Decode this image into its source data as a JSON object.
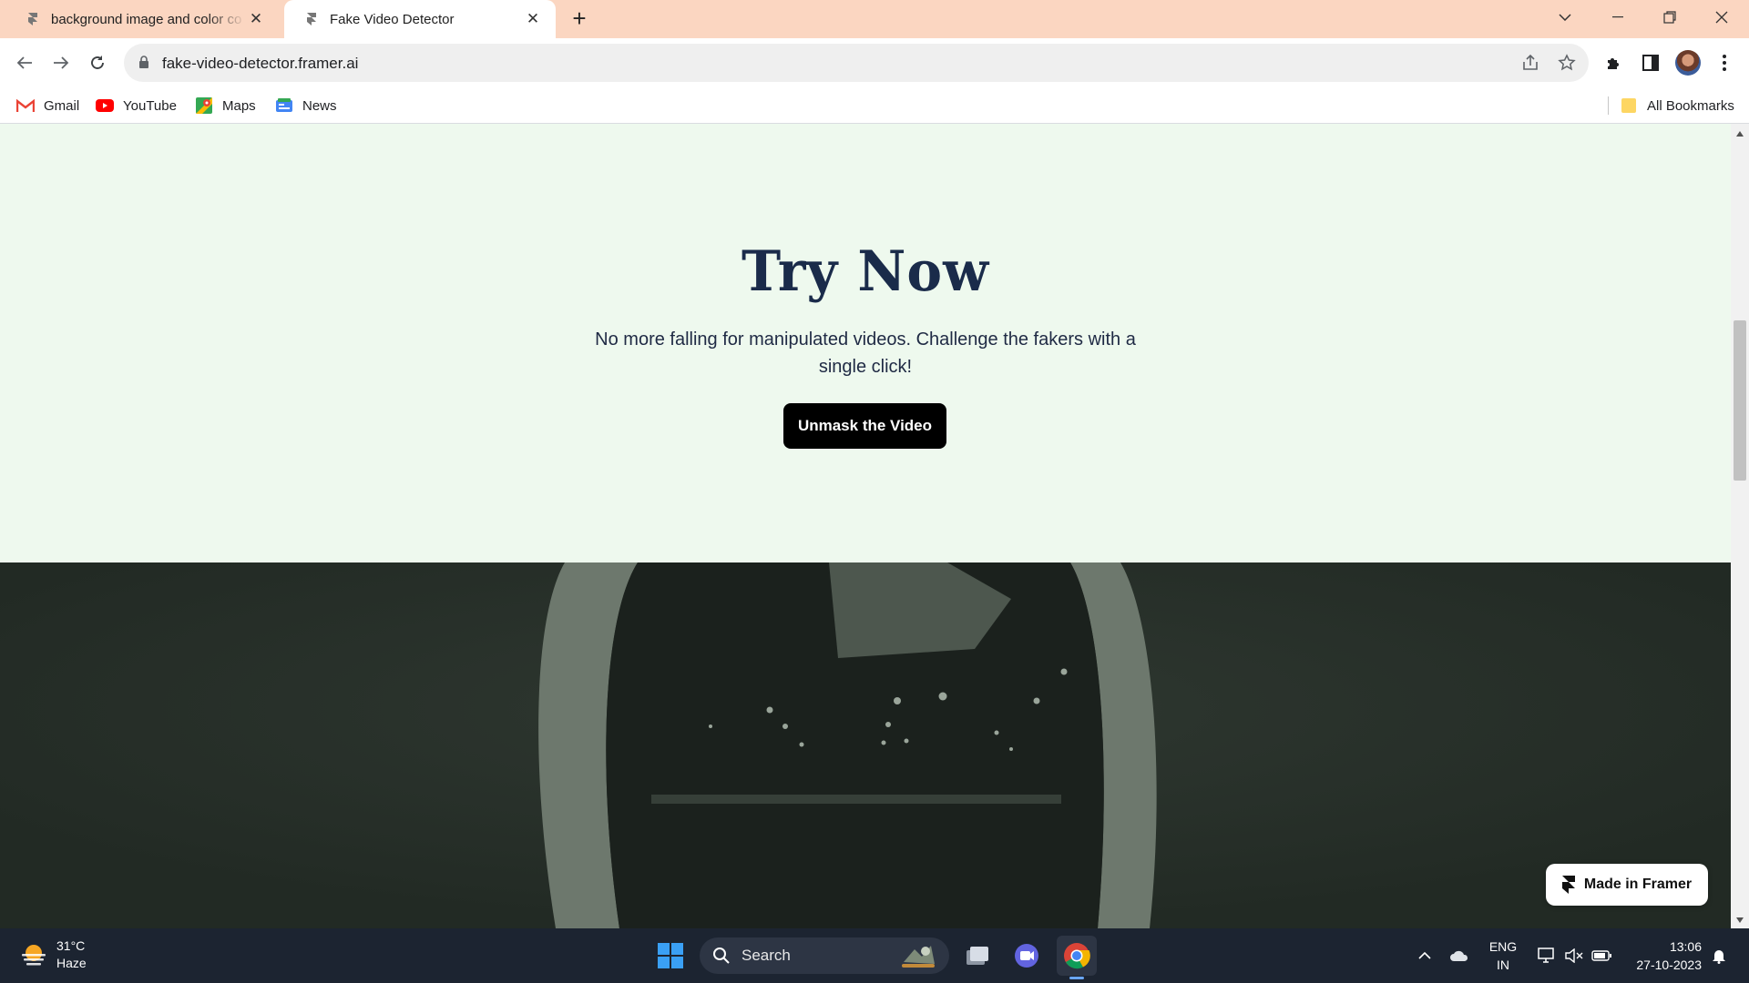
{
  "browser": {
    "tabs": [
      {
        "title": "background image and color co",
        "active": false
      },
      {
        "title": "Fake Video Detector",
        "active": true
      }
    ],
    "address": "fake-video-detector.framer.ai",
    "bookmarks": [
      {
        "label": "Gmail",
        "icon": "gmail-icon"
      },
      {
        "label": "YouTube",
        "icon": "youtube-icon"
      },
      {
        "label": "Maps",
        "icon": "maps-icon"
      },
      {
        "label": "News",
        "icon": "news-icon"
      }
    ],
    "all_bookmarks": "All Bookmarks"
  },
  "page": {
    "hero": {
      "title": "Try Now",
      "subtitle": "No more falling for manipulated videos. Challenge the fakers with a single click!",
      "cta": "Unmask the Video"
    },
    "badge": "Made in Framer",
    "colors": {
      "hero_bg": "#eef9ee",
      "title": "#1a2b4a",
      "dark_bg": "#262e28"
    }
  },
  "taskbar": {
    "weather": {
      "temp": "31°C",
      "condition": "Haze"
    },
    "search": "Search",
    "language": {
      "line1": "ENG",
      "line2": "IN"
    },
    "clock": {
      "time": "13:06",
      "date": "27-10-2023"
    }
  }
}
